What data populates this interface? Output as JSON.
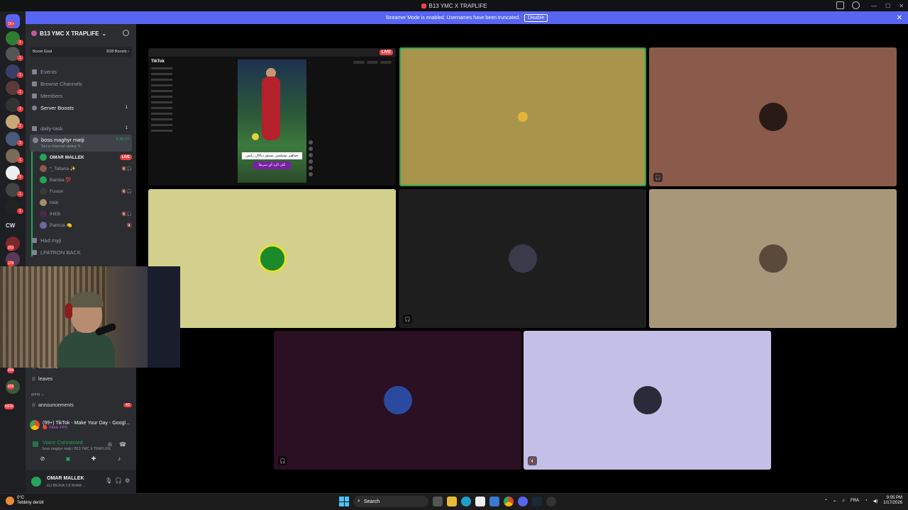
{
  "window": {
    "title": "B13 YMC X TRAPLIFE"
  },
  "banner": {
    "text": "Streamer Mode is enabled. Usernames have been truncated.",
    "disable_label": "Disable",
    "close": "✕"
  },
  "rail": {
    "badges": [
      "1K+",
      "1",
      "1",
      "1",
      "1",
      "1",
      "2",
      "3",
      "1",
      "2",
      "1",
      "1",
      "262",
      "174",
      "664",
      "628",
      "NEW"
    ],
    "cw_label": "CW"
  },
  "server": {
    "name": "B13 YMC X TRAPLIFE",
    "boost_goal": "Boost Goal",
    "boost_count": "3/28 Boosts ›"
  },
  "nav": [
    {
      "label": "Events",
      "count": ""
    },
    {
      "label": "Browse Channels",
      "count": ""
    },
    {
      "label": "Members",
      "count": ""
    },
    {
      "label": "Server Boosts",
      "count": "1"
    }
  ],
  "channels": {
    "daily_task": {
      "label": "daily-task",
      "count": "1"
    },
    "active_voice": {
      "name": "boss maghyr matji",
      "status": "Set a channel status ✎",
      "timer": "5:36:07"
    },
    "voice_users": [
      {
        "name": "OMAR MALLEK",
        "tag": "LIVE",
        "color": "#23a55a"
      },
      {
        "name": "*_Tatiana ✨",
        "tag": "🔇🎧",
        "color": "#8a5a4a"
      },
      {
        "name": "Bamba 💯",
        "tag": "",
        "color": "#23a55a"
      },
      {
        "name": "Fusion",
        "tag": "🔇🎧",
        "color": "#3a3a3a"
      },
      {
        "name": "hbib",
        "tag": "",
        "color": "#a09070"
      },
      {
        "name": "IHEB",
        "tag": "🔇🎧",
        "color": "#4a2a4a"
      },
      {
        "name": "Patricia 🍋",
        "tag": "🔇",
        "color": "#6a6aa0"
      }
    ],
    "other_voice": [
      "Had myji",
      "LPATRON BACK"
    ],
    "text": [
      {
        "label": "welcome",
        "count": ""
      },
      {
        "label": "leaves",
        "count": ""
      }
    ],
    "category_gang": "gang ⌄",
    "announcements": {
      "label": "announcements",
      "count": "42"
    }
  },
  "activity": {
    "title": "(99+) TikTok - Make Your Day - Googl...",
    "sub": "🔴 Tiktok FPS"
  },
  "voice_panel": {
    "connected": "Voice Connected",
    "location": "boss maghyr matji / B13 YMC X TRAPLIFE"
  },
  "user": {
    "name": "OMAR MALLEK",
    "status": "ELI BE3NA YJI NHAR ..."
  },
  "stream": {
    "live_label": "LIVE",
    "tiktok_logo": "TikTok",
    "caption_1": "جماهير تشيلسي تستفز دياكان رايس",
    "caption_2": "لكن الرد آي سريقا"
  },
  "tiles": [
    {
      "id": "speaking-user",
      "bg": "#a8944a"
    },
    {
      "id": "tatiana",
      "bg": "#8a5a4a"
    },
    {
      "id": "bamba",
      "bg": "#d2d08c"
    },
    {
      "id": "fusion",
      "bg": "#1e1e1e"
    },
    {
      "id": "hbib",
      "bg": "#a8987a"
    },
    {
      "id": "iheb",
      "bg": "#2b0f23"
    },
    {
      "id": "patricia",
      "bg": "#c4bfe6"
    }
  ],
  "taskbar": {
    "weather_temp": "0°C",
    "weather_desc": "Tebbiny derûlt",
    "search_label": "Search",
    "language": "FRA",
    "time": "9:05 PM",
    "date": "1/17/2026"
  },
  "colors": {
    "blurple": "#5865f2",
    "green": "#23a55a",
    "red": "#ed4245",
    "sidebar": "#2b2d31",
    "rail": "#1e1f22"
  }
}
